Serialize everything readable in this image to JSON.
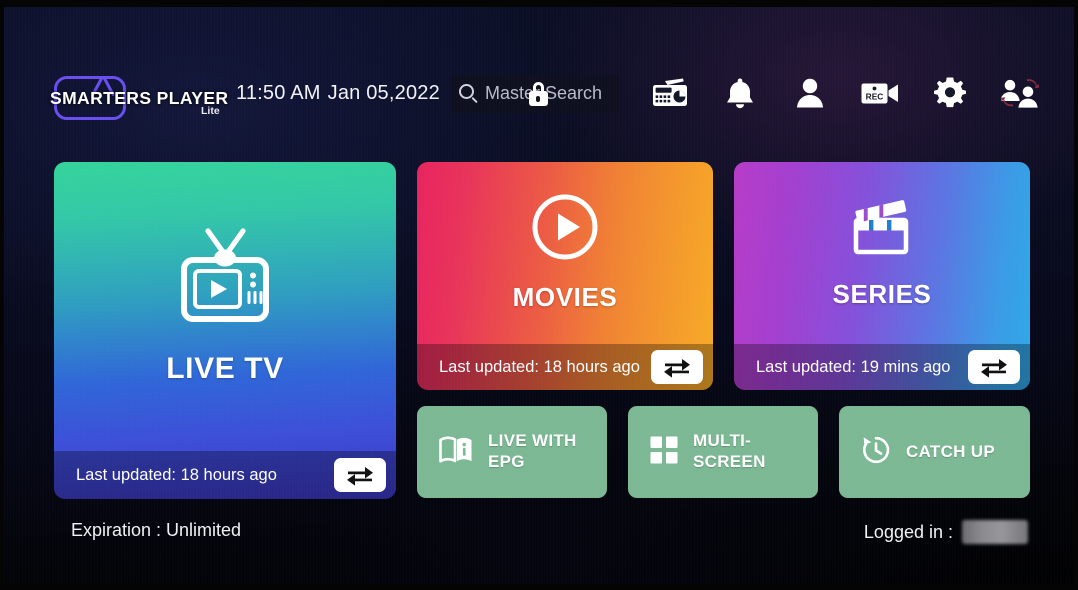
{
  "app": {
    "logo_text": "SMARTERS PLAYER",
    "logo_sub": "Lite",
    "logo_icon": "tv-antenna-icon"
  },
  "header": {
    "time": "11:50 AM",
    "date": "Jan 05,2022",
    "search": {
      "placeholder": "Master Search",
      "icon": "search-icon",
      "lock_icon": "lock-icon"
    },
    "icons": [
      {
        "name": "radio-icon",
        "label": "Radio"
      },
      {
        "name": "bell-icon",
        "label": "Notifications"
      },
      {
        "name": "person-icon",
        "label": "Account"
      },
      {
        "name": "rec-camera-icon",
        "label": "REC"
      },
      {
        "name": "gear-icon",
        "label": "Settings"
      },
      {
        "name": "switch-user-icon",
        "label": "Switch User"
      }
    ],
    "rec_label": "REC"
  },
  "tiles": [
    {
      "id": "live",
      "title": "LIVE TV",
      "icon": "retro-tv-play-icon",
      "updated": "Last updated: 18 hours ago",
      "refresh_icon": "refresh-loop-icon"
    },
    {
      "id": "movies",
      "title": "MOVIES",
      "icon": "play-circle-icon",
      "updated": "Last updated: 18 hours ago",
      "refresh_icon": "refresh-loop-icon"
    },
    {
      "id": "series",
      "title": "SERIES",
      "icon": "clapperboard-icon",
      "updated": "Last updated: 19 mins ago",
      "refresh_icon": "refresh-loop-icon"
    }
  ],
  "actions": [
    {
      "id": "epg",
      "label": "LIVE WITH\nEPG",
      "icon": "book-info-icon"
    },
    {
      "id": "multi",
      "label": "MULTI-SCREEN",
      "icon": "grid-four-icon"
    },
    {
      "id": "catch",
      "label": "CATCH UP",
      "icon": "clock-rewind-icon"
    }
  ],
  "footer": {
    "expiration": "Expiration : Unlimited",
    "logged_in_label": "Logged in :",
    "logged_in_value": ""
  },
  "colors": {
    "background": "#0a0d22",
    "action_green": "#7cb894",
    "live_from": "#35d49b",
    "live_to": "#3b36c4",
    "movies_from": "#e8245f",
    "movies_to": "#f7ab27",
    "series_from": "#b73cc8",
    "series_to": "#2fa8e8",
    "logo_accent": "#6a4ff0"
  }
}
